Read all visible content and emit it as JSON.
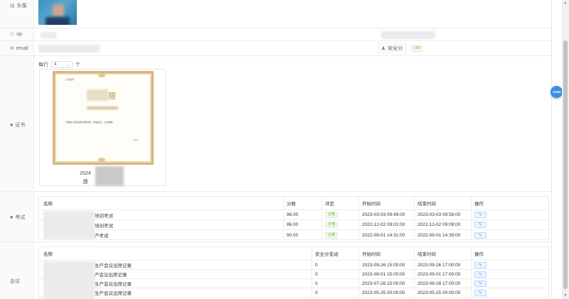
{
  "labels": {
    "avatar": "头像",
    "op": "op",
    "email": "email",
    "certificate": "证书",
    "exam": "考试",
    "meeting": "会议"
  },
  "security": {
    "label": "安全分",
    "score": "100"
  },
  "certificate": {
    "per_page_label": "每行",
    "per_page_value": "4",
    "per_page_unit": "个",
    "cert_header": "证书编号：",
    "cert_title": "限",
    "cert_body": "普通是公民建设和训练考核，特发此证，以资鼓励。",
    "cert_date": "2023",
    "caption_line1": "2024",
    "caption_line2": "颁"
  },
  "exam": {
    "columns": [
      "名称",
      "分数",
      "评定",
      "开始时间",
      "结束时间",
      "操作"
    ],
    "rows": [
      {
        "name": "培训考试",
        "score": "96.00",
        "rating": "合格",
        "start": "2023-03-03 09:49:00",
        "end": "2023-03-03 09:56:00"
      },
      {
        "name": "培训考试",
        "score": "86.00",
        "rating": "合格",
        "start": "2022-12-02 09:01:00",
        "end": "2022-12-02 09:08:00"
      },
      {
        "name": "产考试",
        "score": "90.00",
        "rating": "合格",
        "start": "2022-09-01 14:31:00",
        "end": "2022-09-01 14:39:00"
      }
    ]
  },
  "meeting": {
    "columns": [
      "名称",
      "安全分变动",
      "开始时间",
      "结束时间",
      "操作"
    ],
    "rows": [
      {
        "name": "生产会议出席记录",
        "change": "0",
        "start": "2023-09-26 15:00:00",
        "end": "2023-09-26 17:00:00"
      },
      {
        "name": "产会议出席记录",
        "change": "0",
        "start": "2023-09-01 15:00:00",
        "end": "2023-09-01 17:00:00"
      },
      {
        "name": "生产会议出席记录",
        "change": "0",
        "start": "2023-07-28 15:00:00",
        "end": "2023-08-28 17:00:00"
      },
      {
        "name": "生产会议出席记录",
        "change": "0",
        "start": "2023-05-25 00:00:00",
        "end": "2023-05-25 00:00:00"
      }
    ]
  },
  "fab_label": "103M",
  "icons": {
    "avatar": "image-icon",
    "op": "user-icon",
    "email": "mail-icon",
    "certificate": "folder-icon",
    "exam": "folder-icon",
    "security": "person-icon",
    "edit": "edit-icon"
  },
  "colors": {
    "accent": "#409eff",
    "pass_tag": "#67c23a",
    "cert_frame": "#d8b57a",
    "fab": "#3a8ee6"
  }
}
